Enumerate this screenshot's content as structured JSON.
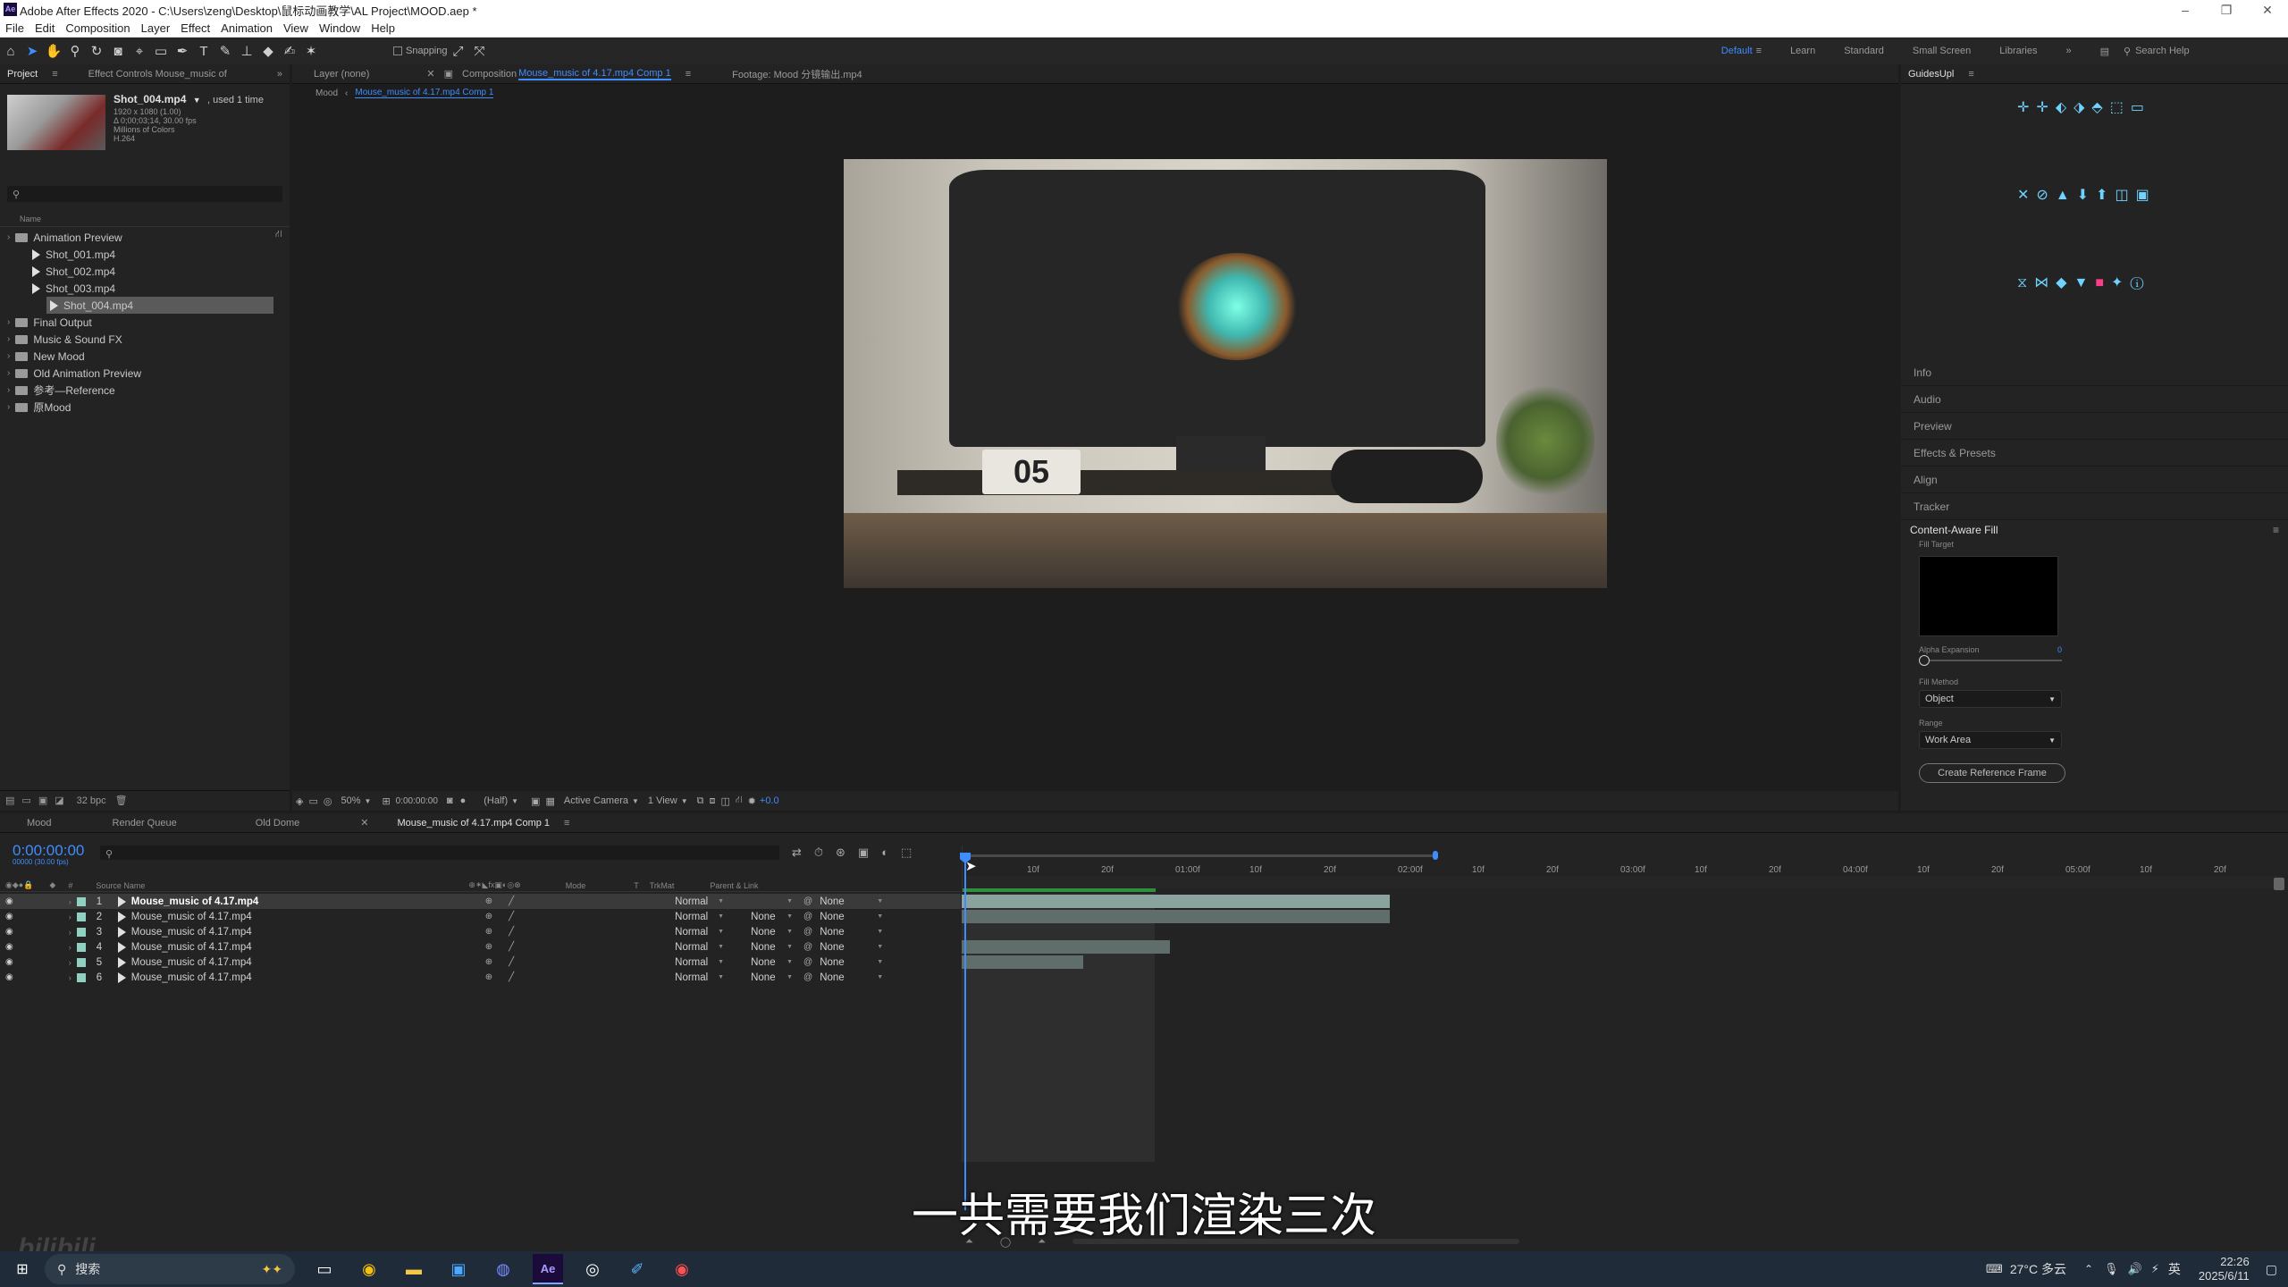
{
  "title": "Adobe After Effects 2020 - C:\\Users\\zeng\\Desktop\\鼠标动画教学\\AL Project\\MOOD.aep *",
  "menu": [
    "File",
    "Edit",
    "Composition",
    "Layer",
    "Effect",
    "Animation",
    "View",
    "Window",
    "Help"
  ],
  "toolbar": {
    "snapping": "Snapping"
  },
  "workspaces": {
    "default": "Default",
    "learn": "Learn",
    "standard": "Standard",
    "small": "Small Screen",
    "libraries": "Libraries",
    "search": "Search Help"
  },
  "project": {
    "tab": "Project",
    "effect_tab": "Effect Controls  Mouse_music of",
    "selected_name": "Shot_004.mp4",
    "used": ", used 1 time",
    "info": [
      "1920 x 1080 (1.00)",
      "Δ 0;00;03;14, 30.00 fps",
      "Millions of Colors",
      "H.264"
    ],
    "search_placeholder": "",
    "col_name": "Name",
    "items": [
      {
        "label": "Animation Preview",
        "type": "folder",
        "indent": 0
      },
      {
        "label": "Shot_001.mp4",
        "type": "file",
        "indent": 1
      },
      {
        "label": "Shot_002.mp4",
        "type": "file",
        "indent": 1
      },
      {
        "label": "Shot_003.mp4",
        "type": "file",
        "indent": 1
      },
      {
        "label": "Shot_004.mp4",
        "type": "file",
        "indent": 1,
        "selected": true
      },
      {
        "label": "Final Output",
        "type": "folder",
        "indent": 0
      },
      {
        "label": "Music & Sound FX",
        "type": "folder",
        "indent": 0
      },
      {
        "label": "New Mood",
        "type": "folder",
        "indent": 0
      },
      {
        "label": "Old Animation Preview",
        "type": "folder",
        "indent": 0
      },
      {
        "label": "参考—Reference",
        "type": "folder",
        "indent": 0
      },
      {
        "label": "原Mood",
        "type": "folder",
        "indent": 0
      }
    ],
    "bpc": "32 bpc"
  },
  "viewer": {
    "layer_tab": "Layer  (none)",
    "comp_tab_prefix": "Composition",
    "comp_tab": "Mouse_music of 4.17.mp4 Comp 1",
    "footage_tab": "Footage: Mood 分镜输出.mp4",
    "crumb_root": "Mood",
    "crumb_comp": "Mouse_music of 4.17.mp4 Comp 1",
    "zoom": "50%",
    "time": "0:00:00:00",
    "quality": "(Half)",
    "camera": "Active Camera",
    "views": "1 View",
    "exposure": "+0.0",
    "calendar_digits": "05"
  },
  "right": {
    "guides_tab": "GuidesUpl",
    "panels": [
      "Info",
      "Audio",
      "Preview",
      "Effects & Presets",
      "Align",
      "Tracker"
    ],
    "caf_title": "Content-Aware Fill",
    "fill_target": "Fill Target",
    "alpha_label": "Alpha Expansion",
    "alpha_value": "0",
    "fill_method_label": "Fill Method",
    "fill_method": "Object",
    "range_label": "Range",
    "range": "Work Area",
    "create_btn": "Create Reference Frame"
  },
  "timeline": {
    "tabs": [
      "Mood",
      "Render Queue",
      "Old Dome",
      "Mouse_music of 4.17.mp4 Comp 1"
    ],
    "timecode": "0:00:00:00",
    "timecode_sub": "00000 (30.00 fps)",
    "col_source": "Source Name",
    "col_mode": "Mode",
    "col_t": "T",
    "col_trkmat": "TrkMat",
    "col_parent": "Parent & Link",
    "ruler": [
      "10f",
      "20f",
      "01:00f",
      "10f",
      "20f",
      "02:00f",
      "10f",
      "20f",
      "03:00f",
      "10f",
      "20f",
      "04:00f",
      "10f",
      "20f",
      "05:00f",
      "10f",
      "20f"
    ],
    "layers": [
      {
        "num": "1",
        "name": "Mouse_music of 4.17.mp4",
        "mode": "Normal",
        "trk": "",
        "parent": "None",
        "selected": true,
        "bar_end": 1555
      },
      {
        "num": "2",
        "name": "Mouse_music of 4.17.mp4",
        "mode": "Normal",
        "trk": "None",
        "parent": "None",
        "bar_end": 1555
      },
      {
        "num": "3",
        "name": "Mouse_music of 4.17.mp4",
        "mode": "Normal",
        "trk": "None",
        "parent": "None",
        "bar_end": 866
      },
      {
        "num": "4",
        "name": "Mouse_music of 4.17.mp4",
        "mode": "Normal",
        "trk": "None",
        "parent": "None",
        "bar_end": 1309
      },
      {
        "num": "5",
        "name": "Mouse_music of 4.17.mp4",
        "mode": "Normal",
        "trk": "None",
        "parent": "None",
        "bar_end": 1212
      },
      {
        "num": "6",
        "name": "Mouse_music of 4.17.mp4",
        "mode": "Normal",
        "trk": "None",
        "parent": "None",
        "bar_end": 769
      }
    ]
  },
  "subtitle": "一共需要我们渲染三次",
  "watermark": "bilibili",
  "taskbar": {
    "search": "搜索",
    "weather": "27°C 多云",
    "ime": "英",
    "time": "22:26",
    "date": "2025/6/11"
  }
}
